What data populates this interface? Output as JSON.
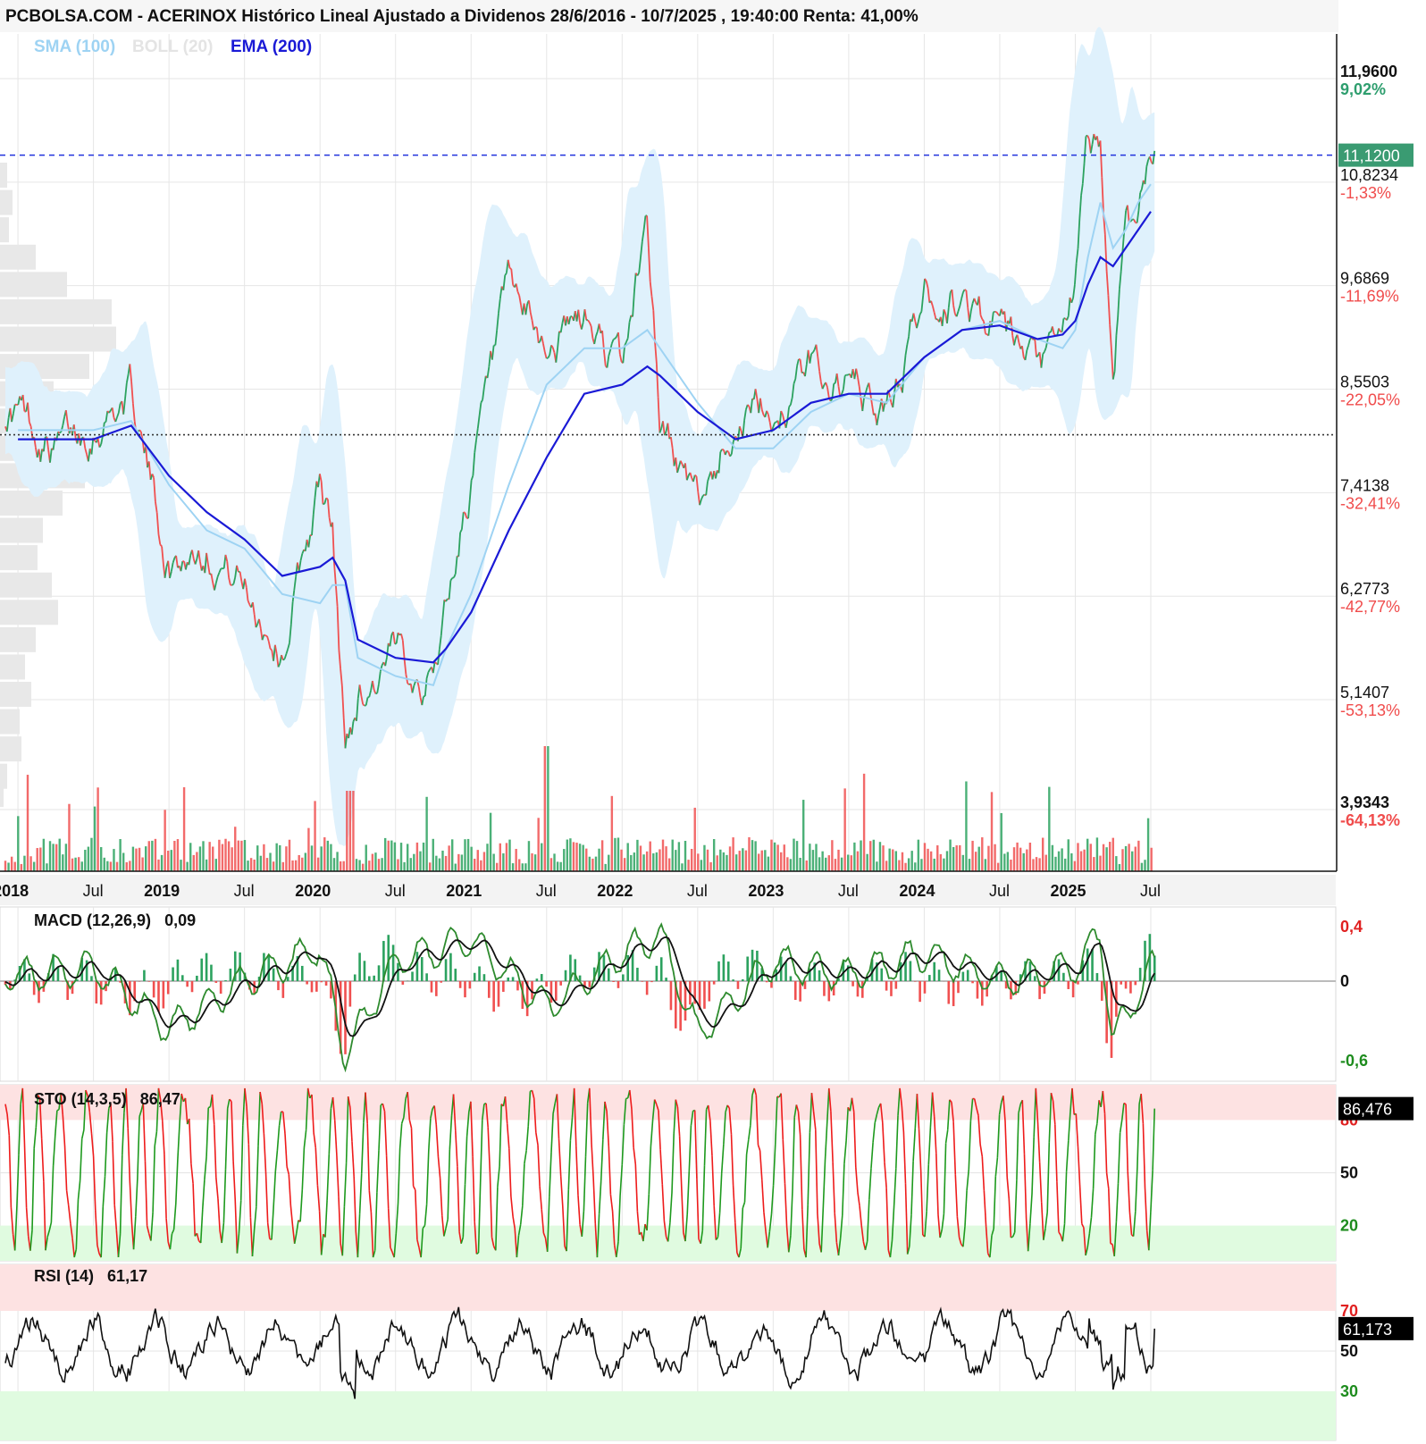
{
  "header": {
    "title": "PCBOLSA.COM - ACERINOX Histórico Lineal Ajustado a Dividenos 28/6/2016 - 10/7/2025 , 19:40:00 Renta: 41,00%"
  },
  "legend": {
    "sma": "SMA (100)",
    "boll": "BOLL (20)",
    "ema": "EMA (200)"
  },
  "colors": {
    "up": "#2ca25f",
    "down": "#f05050",
    "sma": "#9ed3f3",
    "boll_band": "#dff1fc",
    "ema": "#1a1ad6",
    "grid": "#e6e6e6",
    "overbought": "#fde2e2",
    "oversold": "#e0fbe0",
    "current_price_bg": "#3a9b72"
  },
  "price_axis": {
    "levels": [
      {
        "price": "11,9600",
        "pct": "9,02%",
        "pct_color": "#2e9e6e",
        "bold": true
      },
      {
        "price": "10,8234",
        "pct": "-1,33%",
        "pct_color": "#f04c4c",
        "bold": false
      },
      {
        "price": "9,6869",
        "pct": "-11,69%",
        "pct_color": "#f04c4c",
        "bold": false
      },
      {
        "price": "8,5503",
        "pct": "-22,05%",
        "pct_color": "#f04c4c",
        "bold": false
      },
      {
        "price": "7,4138",
        "pct": "-32,41%",
        "pct_color": "#f04c4c",
        "bold": false
      },
      {
        "price": "6,2773",
        "pct": "-42,77%",
        "pct_color": "#f04c4c",
        "bold": false
      },
      {
        "price": "5,1407",
        "pct": "-53,13%",
        "pct_color": "#f04c4c",
        "bold": false
      },
      {
        "price": "3,9343",
        "pct": "-64,13%",
        "pct_color": "#f04c4c",
        "bold": true
      }
    ],
    "current_price": "11,1200"
  },
  "x_axis": {
    "labels": [
      {
        "text": "2018",
        "bold": true
      },
      {
        "text": "Jul",
        "bold": false
      },
      {
        "text": "2019",
        "bold": true
      },
      {
        "text": "Jul",
        "bold": false
      },
      {
        "text": "2020",
        "bold": true
      },
      {
        "text": "Jul",
        "bold": false
      },
      {
        "text": "2021",
        "bold": true
      },
      {
        "text": "Jul",
        "bold": false
      },
      {
        "text": "2022",
        "bold": true
      },
      {
        "text": "Jul",
        "bold": false
      },
      {
        "text": "2023",
        "bold": true
      },
      {
        "text": "Jul",
        "bold": false
      },
      {
        "text": "2024",
        "bold": true
      },
      {
        "text": "Jul",
        "bold": false
      },
      {
        "text": "2025",
        "bold": true
      },
      {
        "text": "Jul",
        "bold": false
      }
    ]
  },
  "macd": {
    "label": "MACD (12,26,9)",
    "value": "0,09",
    "ticks": [
      {
        "text": "0,4",
        "color": "#e02020"
      },
      {
        "text": "0",
        "color": "#111111"
      },
      {
        "text": "-0,6",
        "color": "#1e8c1e"
      }
    ]
  },
  "sto": {
    "label": "STO (14,3,5)",
    "value": "86,47",
    "current": "86,476",
    "ticks": [
      {
        "text": "80",
        "color": "#e02020"
      },
      {
        "text": "50",
        "color": "#111111"
      },
      {
        "text": "20",
        "color": "#1e8c1e"
      }
    ]
  },
  "rsi": {
    "label": "RSI (14)",
    "value": "61,17",
    "current": "61,173",
    "ticks": [
      {
        "text": "70",
        "color": "#e02020"
      },
      {
        "text": "50",
        "color": "#111111"
      },
      {
        "text": "30",
        "color": "#1e8c1e"
      }
    ]
  },
  "chart_data": {
    "type": "line",
    "title": "ACERINOX Histórico Lineal Ajustado a Dividenos 28/6/2016 - 10/7/2025",
    "x": [
      "2018-01",
      "2018-04",
      "2018-07",
      "2018-10",
      "2019-01",
      "2019-04",
      "2019-07",
      "2019-10",
      "2020-01",
      "2020-02",
      "2020-03",
      "2020-04",
      "2020-07",
      "2020-10",
      "2020-11",
      "2021-01",
      "2021-04",
      "2021-07",
      "2021-10",
      "2022-01",
      "2022-03",
      "2022-04",
      "2022-07",
      "2022-10",
      "2023-01",
      "2023-04",
      "2023-07",
      "2023-10",
      "2024-01",
      "2024-04",
      "2024-07",
      "2024-10",
      "2024-12",
      "2025-01",
      "2025-02",
      "2025-03",
      "2025-04",
      "2025-05",
      "2025-06",
      "2025-07"
    ],
    "series": [
      {
        "name": "Precio",
        "values": [
          8.3,
          7.9,
          8.2,
          8.5,
          6.6,
          6.9,
          6.4,
          5.7,
          7.5,
          6.9,
          4.5,
          5.2,
          5.6,
          5.4,
          6.2,
          7.6,
          9.5,
          9.0,
          9.3,
          8.7,
          10.5,
          8.2,
          7.2,
          8.3,
          8.3,
          8.8,
          8.6,
          8.2,
          9.6,
          9.5,
          9.2,
          8.6,
          9.0,
          9.7,
          11.2,
          11.3,
          8.5,
          10.6,
          10.4,
          11.12
        ]
      },
      {
        "name": "SMA (100)",
        "values": [
          8.1,
          8.1,
          8.1,
          8.2,
          7.5,
          7.0,
          6.8,
          6.3,
          6.2,
          6.4,
          6.4,
          5.6,
          5.4,
          5.3,
          5.7,
          6.3,
          7.5,
          8.6,
          9.0,
          9.0,
          9.2,
          9.0,
          8.4,
          7.9,
          7.9,
          8.3,
          8.5,
          8.4,
          8.9,
          9.2,
          9.3,
          9.1,
          9.0,
          9.2,
          10.0,
          10.6,
          10.1,
          10.3,
          10.6,
          10.8
        ]
      },
      {
        "name": "EMA (200)",
        "values": [
          8.0,
          8.0,
          8.0,
          8.15,
          7.6,
          7.2,
          6.9,
          6.5,
          6.6,
          6.7,
          6.45,
          5.8,
          5.6,
          5.55,
          5.7,
          6.1,
          7.0,
          7.8,
          8.5,
          8.6,
          8.8,
          8.7,
          8.3,
          8.0,
          8.1,
          8.4,
          8.5,
          8.5,
          8.9,
          9.2,
          9.25,
          9.1,
          9.15,
          9.3,
          9.7,
          10.0,
          9.9,
          10.1,
          10.3,
          10.5
        ]
      }
    ],
    "macd": {
      "x": [
        "2018-01",
        "2018-07",
        "2019-01",
        "2019-07",
        "2020-01",
        "2020-03",
        "2020-07",
        "2021-01",
        "2021-07",
        "2022-01",
        "2022-04",
        "2022-07",
        "2023-01",
        "2023-07",
        "2024-01",
        "2024-07",
        "2025-01",
        "2025-03",
        "2025-04",
        "2025-07"
      ],
      "values": [
        0.05,
        0.1,
        -0.35,
        0.0,
        0.25,
        -0.55,
        0.15,
        0.3,
        -0.2,
        0.2,
        0.35,
        -0.4,
        0.15,
        0.05,
        0.2,
        0.0,
        0.1,
        0.35,
        -0.45,
        0.09
      ]
    },
    "sto": {
      "current": 86.476,
      "overbought": 80,
      "oversold": 20
    },
    "rsi": {
      "current": 61.173,
      "overbought": 70,
      "oversold": 30
    },
    "ylim": [
      3.9343,
      11.96
    ]
  }
}
